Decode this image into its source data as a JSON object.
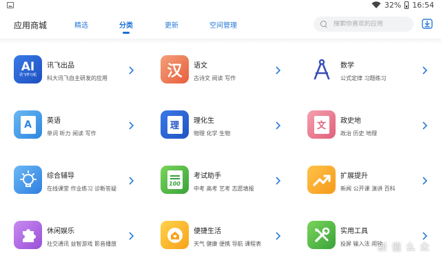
{
  "statusbar": {
    "battery": "32%",
    "time": "16:54"
  },
  "header": {
    "title": "应用商城",
    "tabs": [
      {
        "label": "精选"
      },
      {
        "label": "分类"
      },
      {
        "label": "更新"
      },
      {
        "label": "空间管理"
      }
    ],
    "active_tab": "分类",
    "search_placeholder": "搜索你喜欢的应用"
  },
  "categories": [
    {
      "name": "讯飞出品",
      "desc": "科大讯飞自主研发的应用",
      "icon": "ai-learning-device-icon",
      "badge_big": "AI",
      "badge_small": "讯飞学习机",
      "colors": [
        "#3a7ae6",
        "#1d4fc0"
      ]
    },
    {
      "name": "语文",
      "desc": "古诗文 阅读 写作",
      "icon": "chinese-character-icon",
      "glyph": "汉",
      "colors": [
        "#f3a07a",
        "#e85e3c"
      ]
    },
    {
      "name": "数学",
      "desc": "公式定律 习题练习",
      "icon": "compass-icon",
      "colors": [
        "#ffffff",
        "#ffffff"
      ]
    },
    {
      "name": "英语",
      "desc": "单词 听力 阅读 写作",
      "icon": "english-book-icon",
      "glyph": "A",
      "colors": [
        "#6ab8f2",
        "#2d86e0"
      ]
    },
    {
      "name": "理化生",
      "desc": "物理 化学 生物",
      "icon": "science-book-icon",
      "glyph": "理",
      "colors": [
        "#3a7ae6",
        "#2152c4"
      ]
    },
    {
      "name": "政史地",
      "desc": "政治 历史 地理",
      "icon": "politics-book-icon",
      "glyph": "文",
      "colors": [
        "#f5a0b0",
        "#e0607a"
      ]
    },
    {
      "name": "综合辅导",
      "desc": "在线课堂 作业练习 诊断答疑",
      "icon": "lightbulb-icon",
      "colors": [
        "#6bb8f5",
        "#2f7fe0"
      ]
    },
    {
      "name": "考试助手",
      "desc": "中考 高考 艺考 志愿填报",
      "icon": "exam-paper-icon",
      "glyph": "100",
      "colors": [
        "#7ad45a",
        "#3aa23a"
      ]
    },
    {
      "name": "扩展提升",
      "desc": "新闻 公开课 演讲 百科",
      "icon": "trend-up-icon",
      "colors": [
        "#ffc24a",
        "#f59a1a"
      ]
    },
    {
      "name": "休闲娱乐",
      "desc": "社交通讯 益智游戏 影音播放",
      "icon": "puzzle-icon",
      "colors": [
        "#c88af0",
        "#9a50d8"
      ]
    },
    {
      "name": "便捷生活",
      "desc": "天气 健康 便携 导航 课程表",
      "icon": "home-heart-icon",
      "colors": [
        "#ffd24a",
        "#f7a21a"
      ]
    },
    {
      "name": "实用工具",
      "desc": "投屏 输入法 闹钟",
      "icon": "tools-icon",
      "colors": [
        "#7ad45a",
        "#3aa23a"
      ]
    }
  ],
  "watermark": "新 值 么 众"
}
